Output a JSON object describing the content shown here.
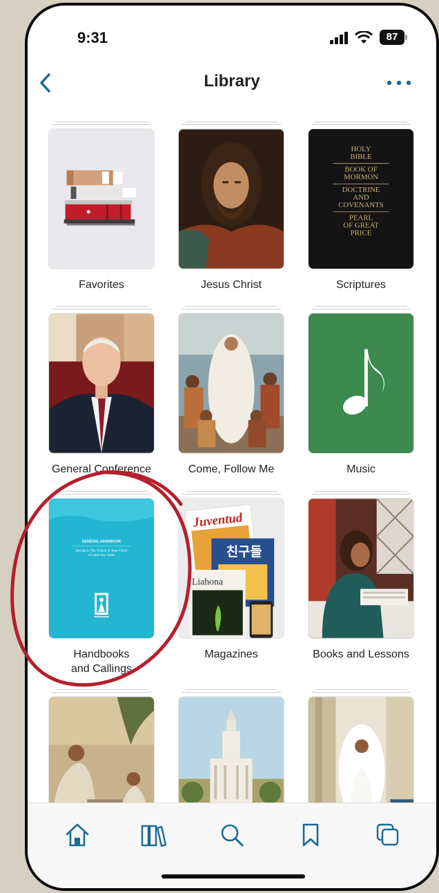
{
  "status_bar": {
    "time": "9:31",
    "battery": "87"
  },
  "header": {
    "title": "Library"
  },
  "tiles": [
    {
      "label": "Favorites"
    },
    {
      "label": "Jesus Christ"
    },
    {
      "label": "Scriptures",
      "cover_lines": [
        "HOLY",
        "BIBLE",
        "BOOK OF",
        "MORMON",
        "DOCTRINE",
        "AND",
        "COVENANTS",
        "PEARL",
        "OF GREAT",
        "PRICE"
      ]
    },
    {
      "label": "General Conference"
    },
    {
      "label": "Come, Follow Me"
    },
    {
      "label": "Music"
    },
    {
      "label": "Handbooks\nand Callings",
      "cover_title": "GENERAL HANDBOOK",
      "cover_subtitle_1": "Serving in The Church of Jesus Christ",
      "cover_subtitle_2": "of Latter-day Saints"
    },
    {
      "label": "Magazines",
      "mag_1": "Juventud",
      "mag_2": "친구들",
      "mag_3": "Liahona"
    },
    {
      "label": "Books and Lessons"
    }
  ],
  "tab_bar": {
    "items": [
      "home-icon",
      "library-icon",
      "search-icon",
      "bookmark-icon",
      "screens-icon"
    ]
  },
  "colors": {
    "accent": "#1b6a93",
    "annotation": "#b3202e",
    "handbook": "#22b6d3",
    "music": "#3c8a4e",
    "scriptures": "#141414"
  }
}
